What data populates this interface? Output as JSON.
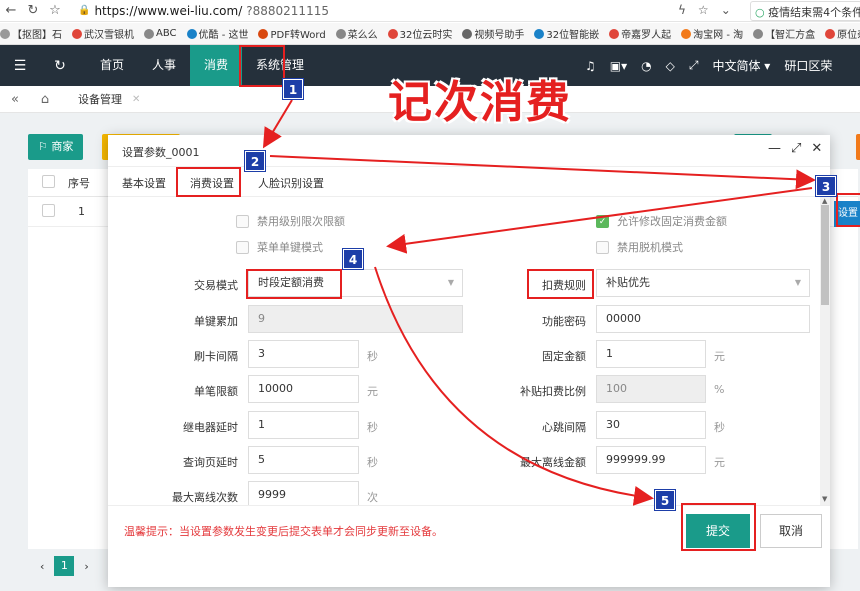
{
  "browser": {
    "url_main": "https://www.wei-liu.com/",
    "url_rest": "?8880211115",
    "search_text": "疫情结束需4个条件"
  },
  "bookmarks": [
    {
      "label": "【抠图】石",
      "color": "#999"
    },
    {
      "label": "武汉雪银机",
      "color": "#e0463a"
    },
    {
      "label": "ABC",
      "color": "#888"
    },
    {
      "label": "优酷 - 这世",
      "color": "#1a82c8"
    },
    {
      "label": "PDF转Word",
      "color": "#d9480f"
    },
    {
      "label": "菜么么",
      "color": "#888"
    },
    {
      "label": "32位云时实",
      "color": "#e0463a"
    },
    {
      "label": "视频号助手",
      "color": "#666"
    },
    {
      "label": "32位智能嵌",
      "color": "#1a82c8"
    },
    {
      "label": "帝嘉罗人起",
      "color": "#e0463a"
    },
    {
      "label": "淘宝网 - 淘",
      "color": "#f27a1a"
    },
    {
      "label": "【智汇方盒",
      "color": "#888"
    },
    {
      "label": "原位杂交 (",
      "color": "#e0463a"
    }
  ],
  "app_header": {
    "menus": [
      "首页",
      "人事",
      "消费",
      "系统管理"
    ],
    "active_menu": "消费",
    "language": "中文简体 ▾",
    "region": "研口区荣"
  },
  "tabbar": {
    "tab_label": "设备管理"
  },
  "background": {
    "merchant_button": "商家",
    "col_index": "序号",
    "row_index": "1",
    "settings_button": "设置",
    "page": "1"
  },
  "modal": {
    "title": "设置参数_0001",
    "tabs": [
      "基本设置",
      "消费设置",
      "人脸识别设置"
    ],
    "checkboxes": {
      "disable_level_limit": "禁用级别限次限额",
      "menu_single_key": "菜单单键模式",
      "allow_modify_fixed": "允许修改固定消费金额",
      "disable_offline": "禁用脱机模式"
    },
    "fields": {
      "trade_mode": {
        "label": "交易模式",
        "value": "时段定额消费"
      },
      "single_key_add": {
        "label": "单键累加",
        "value": "9"
      },
      "card_interval": {
        "label": "刷卡间隔",
        "value": "3",
        "unit": "秒"
      },
      "single_limit": {
        "label": "单笔限额",
        "value": "10000",
        "unit": "元"
      },
      "relay_delay": {
        "label": "继电器延时",
        "value": "1",
        "unit": "秒"
      },
      "query_delay": {
        "label": "查询页延时",
        "value": "5",
        "unit": "秒"
      },
      "max_offline_times": {
        "label": "最大离线次数",
        "value": "9999",
        "unit": "次"
      },
      "deduct_rule": {
        "label": "扣费规则",
        "value": "补贴优先"
      },
      "function_pwd": {
        "label": "功能密码",
        "value": "00000"
      },
      "fixed_amount": {
        "label": "固定金额",
        "value": "1",
        "unit": "元"
      },
      "subsidy_ratio": {
        "label": "补贴扣费比例",
        "value": "100",
        "unit": "%"
      },
      "heartbeat": {
        "label": "心跳间隔",
        "value": "30",
        "unit": "秒"
      },
      "max_offline_amount": {
        "label": "最大离线金额",
        "value": "999999.99",
        "unit": "元"
      }
    },
    "tip": "温馨提示：当设置参数发生变更后提交表单才会同步更新至设备。",
    "submit": "提交",
    "cancel": "取消"
  },
  "annotation": {
    "title": "记次消费",
    "badges": [
      "1",
      "2",
      "3",
      "4",
      "5"
    ],
    "accent_color": "#e52020",
    "badge_color": "#1d3ea8"
  }
}
